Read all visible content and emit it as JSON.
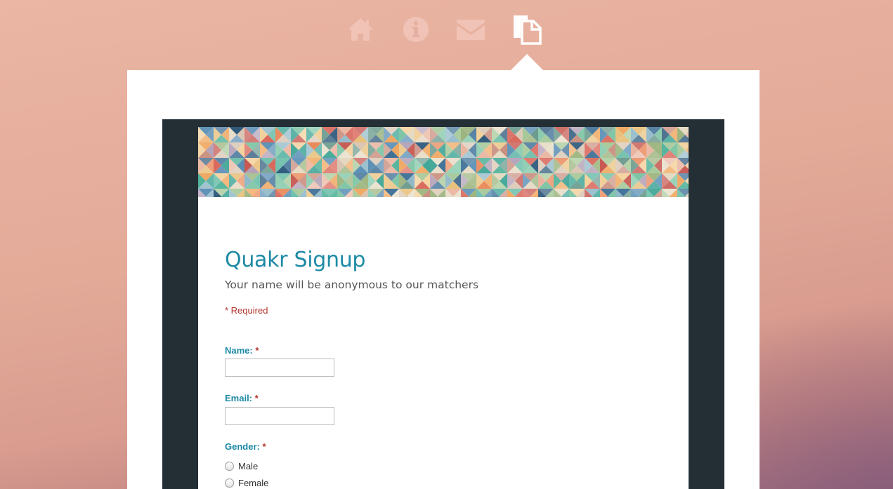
{
  "nav": {
    "icons": [
      "home-icon",
      "info-icon",
      "mail-icon",
      "document-icon"
    ],
    "active": "document-icon",
    "icon_color": "#f1c3b6",
    "active_color": "#ffffff"
  },
  "form": {
    "title": "Quakr Signup",
    "description": "Your name will be anonymous to our matchers",
    "required_note": "* Required",
    "fields": [
      {
        "label": "Name:",
        "required_mark": "*",
        "value": ""
      },
      {
        "label": "Email:",
        "required_mark": "*",
        "value": ""
      }
    ],
    "gender": {
      "label": "Gender:",
      "required_mark": "*",
      "options": [
        "Male",
        "Female"
      ]
    }
  },
  "colors": {
    "accent": "#1d8aa5",
    "required": "#b0342a",
    "frame": "#232e35"
  }
}
